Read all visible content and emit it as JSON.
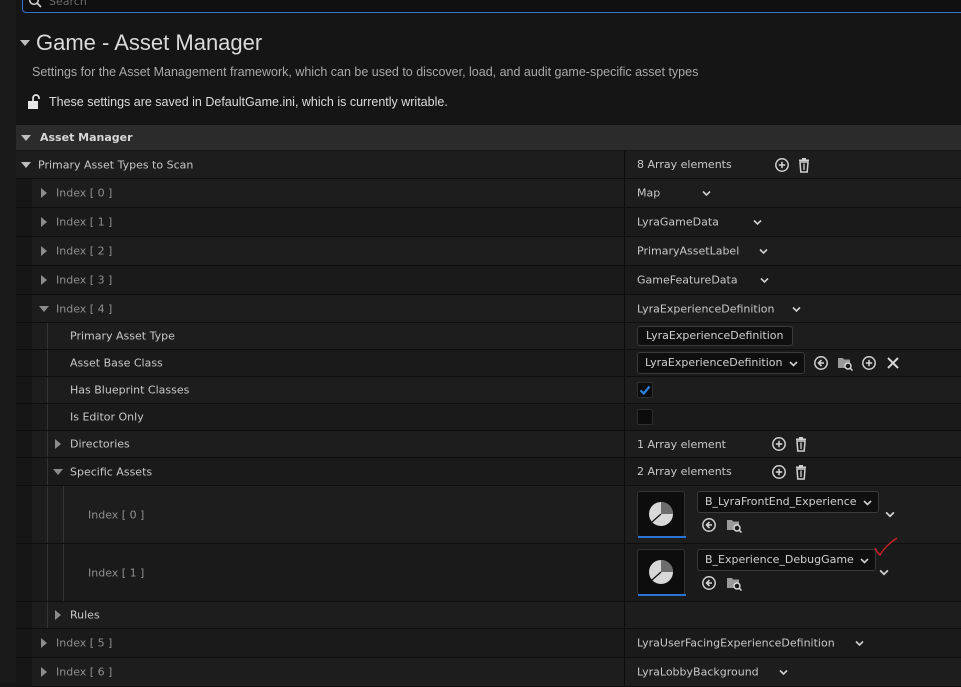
{
  "search": {
    "placeholder": "Search"
  },
  "header": {
    "title": "Game - Asset Manager",
    "description": "Settings for the Asset Management framework, which can be used to discover, load, and audit game-specific asset types",
    "notice": "These settings are saved in DefaultGame.ini, which is currently writable."
  },
  "section": {
    "label": "Asset Manager"
  },
  "primary": {
    "label": "Primary Asset Types to Scan",
    "count": "8 Array elements",
    "indices": [
      {
        "label": "Index [ 0 ]",
        "value": "Map"
      },
      {
        "label": "Index [ 1 ]",
        "value": "LyraGameData"
      },
      {
        "label": "Index [ 2 ]",
        "value": "PrimaryAssetLabel"
      },
      {
        "label": "Index [ 3 ]",
        "value": "GameFeatureData"
      },
      {
        "label": "Index [ 4 ]",
        "value": "LyraExperienceDefinition"
      },
      {
        "label": "Index [ 5 ]",
        "value": "LyraUserFacingExperienceDefinition"
      },
      {
        "label": "Index [ 6 ]",
        "value": "LyraLobbyBackground"
      }
    ]
  },
  "index4": {
    "primary_asset_type_label": "Primary Asset Type",
    "primary_asset_type_value": "LyraExperienceDefinition",
    "asset_base_class_label": "Asset Base Class",
    "asset_base_class_value": "LyraExperienceDefinition",
    "has_blueprint_classes_label": "Has Blueprint Classes",
    "has_blueprint_classes": true,
    "is_editor_only_label": "Is Editor Only",
    "is_editor_only": false,
    "directories_label": "Directories",
    "directories_count": "1 Array element",
    "specific_assets_label": "Specific Assets",
    "specific_assets_count": "2 Array elements",
    "specific_assets": [
      {
        "label": "Index [ 0 ]",
        "value": "B_LyraFrontEnd_Experience"
      },
      {
        "label": "Index [ 1 ]",
        "value": "B_Experience_DebugGame"
      }
    ],
    "rules_label": "Rules"
  },
  "colors": {
    "accent": "#2a74d6",
    "annotation": "#d0202a",
    "checkbox_check": "#2f7fe0"
  }
}
